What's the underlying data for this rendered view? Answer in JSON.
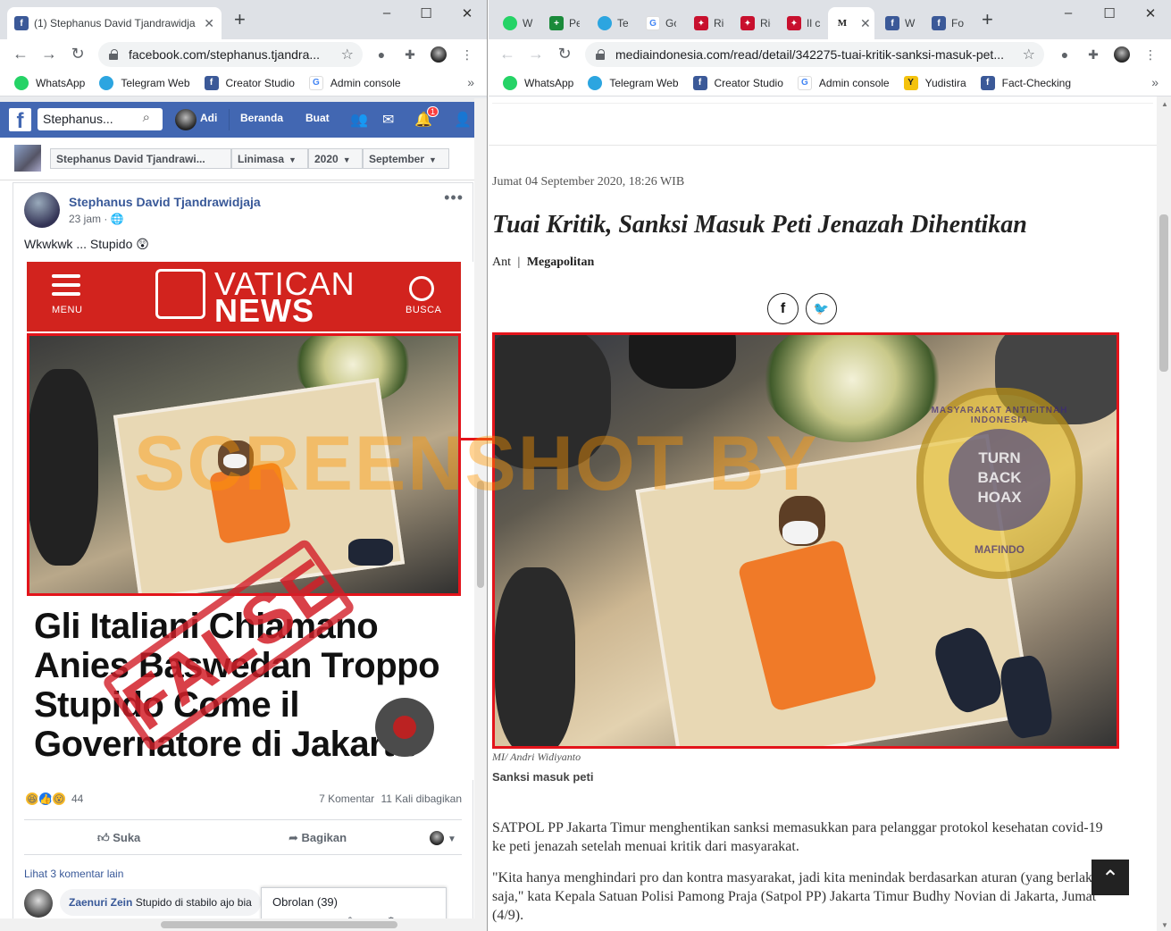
{
  "left_browser": {
    "tab_title": "(1) Stephanus David Tjandrawidja",
    "new_tab": "+",
    "window_controls": [
      "–",
      "☐",
      "✕"
    ],
    "url": "facebook.com/stephanus.tjandra...",
    "bookmarks": [
      {
        "label": "WhatsApp",
        "icon": "whatsapp-icon"
      },
      {
        "label": "Telegram Web",
        "icon": "telegram-icon"
      },
      {
        "label": "Creator Studio",
        "icon": "facebook-icon"
      },
      {
        "label": "Admin console",
        "icon": "google-icon"
      }
    ],
    "bookmarks_more": "»"
  },
  "facebook": {
    "search_value": "Stephanus...",
    "user_name": "Adi",
    "nav": [
      "Beranda",
      "Buat"
    ],
    "notification_count": "1",
    "breadcrumb": [
      "Stephanus David Tjandrawi...",
      "Linimasa",
      "2020",
      "September"
    ],
    "post": {
      "author": "Stephanus David Tjandrawidjaja",
      "time": "23 jam · ",
      "text": "Wkwkwk ... Stupido 😲",
      "image": {
        "header_title_1": "VATICAN",
        "header_title_2": "NEWS",
        "menu_label": "MENU",
        "search_label": "BUSCA",
        "headline": "Gli Italiani Chiamano Anies Baswedan Troppo Stupido Come il Governatore di Jakarta",
        "stamp": "FALSE"
      },
      "reaction_count": "44",
      "comments_count": "7 Komentar",
      "shares_count": "11 Kali dibagikan",
      "like_label": "Suka",
      "share_label": "Bagikan",
      "more_comments": "Lihat 3 komentar lain",
      "comment": {
        "author": "Zaenuri Zein",
        "text": "Stupido di stabilo ajo bia"
      }
    },
    "chat_label": "Obrolan (39)"
  },
  "right_browser": {
    "tabs": [
      {
        "label": "Wi",
        "icon": "whatsapp-icon"
      },
      {
        "label": "Pe",
        "icon": "green-plus-icon"
      },
      {
        "label": "Tel",
        "icon": "telegram-icon"
      },
      {
        "label": "Gc",
        "icon": "google-translate-icon"
      },
      {
        "label": "Ric",
        "icon": "red-emblem-icon"
      },
      {
        "label": "Ric",
        "icon": "red-emblem-icon"
      },
      {
        "label": "Il c",
        "icon": "red-emblem-icon"
      },
      {
        "label": "MI",
        "icon": "mi-icon",
        "active": true
      },
      {
        "label": "W",
        "icon": "facebook-icon"
      },
      {
        "label": "Fo",
        "icon": "facebook-icon"
      }
    ],
    "new_tab": "+",
    "window_controls": [
      "–",
      "☐",
      "✕"
    ],
    "url": "mediaindonesia.com/read/detail/342275-tuai-kritik-sanksi-masuk-pet...",
    "bookmarks": [
      {
        "label": "WhatsApp",
        "icon": "whatsapp-icon"
      },
      {
        "label": "Telegram Web",
        "icon": "telegram-icon"
      },
      {
        "label": "Creator Studio",
        "icon": "facebook-icon"
      },
      {
        "label": "Admin console",
        "icon": "google-icon"
      },
      {
        "label": "Yudistira",
        "icon": "yudistira-icon"
      },
      {
        "label": "Fact-Checking",
        "icon": "facebook-icon"
      }
    ],
    "bookmarks_more": "»"
  },
  "article": {
    "date": "Jumat 04 September 2020, 18:26 WIB",
    "title": "Tuai Kritik, Sanksi Masuk Peti Jenazah Dihentikan",
    "source": "Ant",
    "separator": "|",
    "category": "Megapolitan",
    "share_buttons": [
      "f",
      "🐦"
    ],
    "photo_credit": "MI/ Andri Widiyanto",
    "photo_caption": "Sanksi masuk peti",
    "paragraph_1": "SATPOL PP Jakarta Timur menghentikan sanksi memasukkan para pelanggar protokol kesehatan covid-19 ke peti jenazah setelah menuai kritik dari masyarakat.",
    "paragraph_2": "\"Kita hanya menghindari pro dan kontra masyarakat, jadi kita menindak berdasarkan aturan (yang berlaku) saja,\" kata Kepala Satuan Polisi Pamong Praja (Satpol PP) Jakarta Timur Budhy Novian di Jakarta, Jumat (4/9).",
    "scroll_top": "⌃"
  },
  "overlay": {
    "watermark": "SCREENSHOT BY",
    "badge_top": "MASYARAKAT ANTIFITNAH INDONESIA",
    "badge_center_1": "TURN",
    "badge_center_2": "BACK",
    "badge_center_3": "HOAX",
    "badge_bottom": "MAFINDO"
  },
  "colors": {
    "facebook_blue": "#4267b2",
    "flag_red": "#e3141b",
    "watermark_orange": "#ff9600"
  }
}
